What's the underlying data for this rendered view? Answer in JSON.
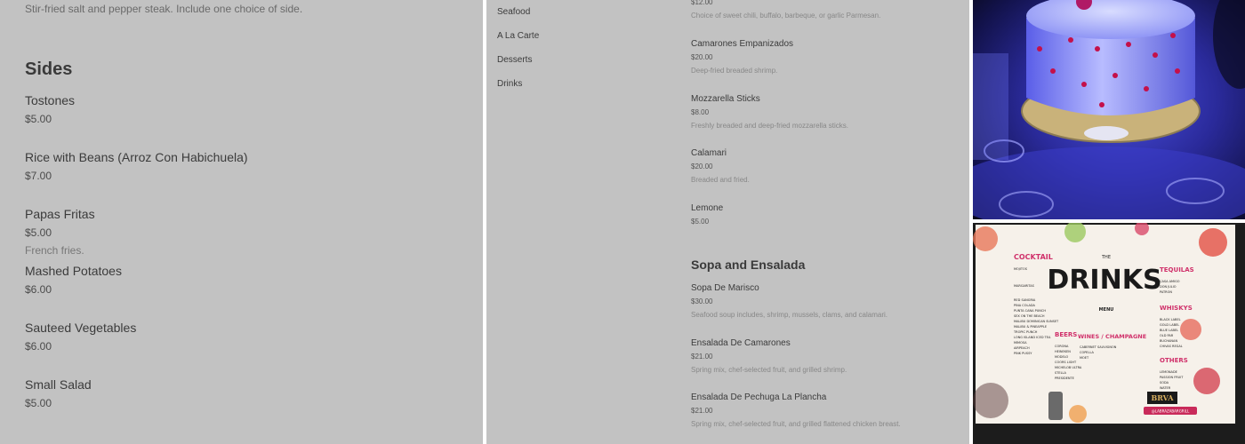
{
  "left_panel": {
    "prev_desc": "Stir-fried salt and pepper steak. Include one choice of side.",
    "heading": "Sides",
    "items": [
      {
        "name": "Tostones",
        "price": "$5.00",
        "desc": ""
      },
      {
        "name": "Rice with Beans (Arroz Con Habichuela)",
        "price": "$7.00",
        "desc": ""
      },
      {
        "name": "Papas Fritas",
        "price": "$5.00",
        "desc": "French fries."
      },
      {
        "name": "Mashed Potatoes",
        "price": "$6.00",
        "desc": ""
      },
      {
        "name": "Sauteed Vegetables",
        "price": "$6.00",
        "desc": ""
      },
      {
        "name": "Small Salad",
        "price": "$5.00",
        "desc": ""
      }
    ]
  },
  "middle_panel": {
    "nav": [
      "Seafood",
      "A La Carte",
      "Desserts",
      "Drinks"
    ],
    "prev_price": "$12.00",
    "prev_desc": "Choice of sweet chili, buffalo, barbeque, or garlic Parmesan.",
    "items": [
      {
        "name": "Camarones Empanizados",
        "price": "$20.00",
        "desc": "Deep-fried breaded shrimp."
      },
      {
        "name": "Mozzarella Sticks",
        "price": "$8.00",
        "desc": "Freshly breaded and deep-fried mozzarella sticks."
      },
      {
        "name": "Calamari",
        "price": "$20.00",
        "desc": "Breaded and fried."
      },
      {
        "name": "Lemone",
        "price": "$5.00",
        "desc": ""
      }
    ],
    "section_heading": "Sopa and Ensalada",
    "section_items": [
      {
        "name": "Sopa De Marisco",
        "price": "$30.00",
        "desc": "Seafood soup includes, shrimp, mussels, clams, and calamari."
      },
      {
        "name": "Ensalada De Camarones",
        "price": "$21.00",
        "desc": "Spring mix, chef-selected fruit, and grilled shrimp."
      },
      {
        "name": "Ensalada De Pechuga La Plancha",
        "price": "$21.00",
        "desc": "Spring mix, chef-selected fruit, and grilled flattened chicken breast."
      }
    ]
  },
  "right_panel": {
    "drinks_menu": {
      "the": "THE",
      "title": "DRINKS",
      "menu_label": "MENU",
      "cocktail_heading": "COCKTAIL",
      "cocktail_items": [
        "MOJITOS",
        "MARGARITAS",
        "RED SANGRIA",
        "PINA COLADA",
        "PUNTA CANA PUNCH",
        "SEX ON THE BEACH",
        "MALIBU DOMINICAN SUNSET",
        "MALIBU & PINEAPPLE",
        "TROPIC PUNCH",
        "LONG ISLAND ICED TEA",
        "MIMOSA",
        "AIRPEACH",
        "PINK PUSSY"
      ],
      "beers_heading": "BEERS",
      "beers_items": [
        "CORONA",
        "HEINEKEN",
        "MODELO",
        "COORS LIGHT",
        "MICHELOB ULTRA",
        "STELLA",
        "PRESIDENTE"
      ],
      "wines_heading": "WINES / CHAMPAGNE",
      "wines_items": [
        "CABERNET SAUVIGNON",
        "COPELLA",
        "MOET"
      ],
      "tequilas_heading": "TEQUILAS",
      "tequilas_items": [
        "CASA AMIGO",
        "DON JULIO",
        "PATRON"
      ],
      "whiskys_heading": "WHISKYS",
      "whiskys_items": [
        "BLACK LABEL",
        "GOLD LABEL",
        "BLUE LABEL",
        "OLD PAR",
        "BUCHANAN",
        "CHIVAS REGAL"
      ],
      "others_heading": "OTHERS",
      "others_items": [
        "LEMONADE",
        "PASSION FRUIT",
        "SODA",
        "WATER"
      ],
      "logo_text": "BRVA",
      "handle": "@LABRAZABARGRILL"
    }
  }
}
